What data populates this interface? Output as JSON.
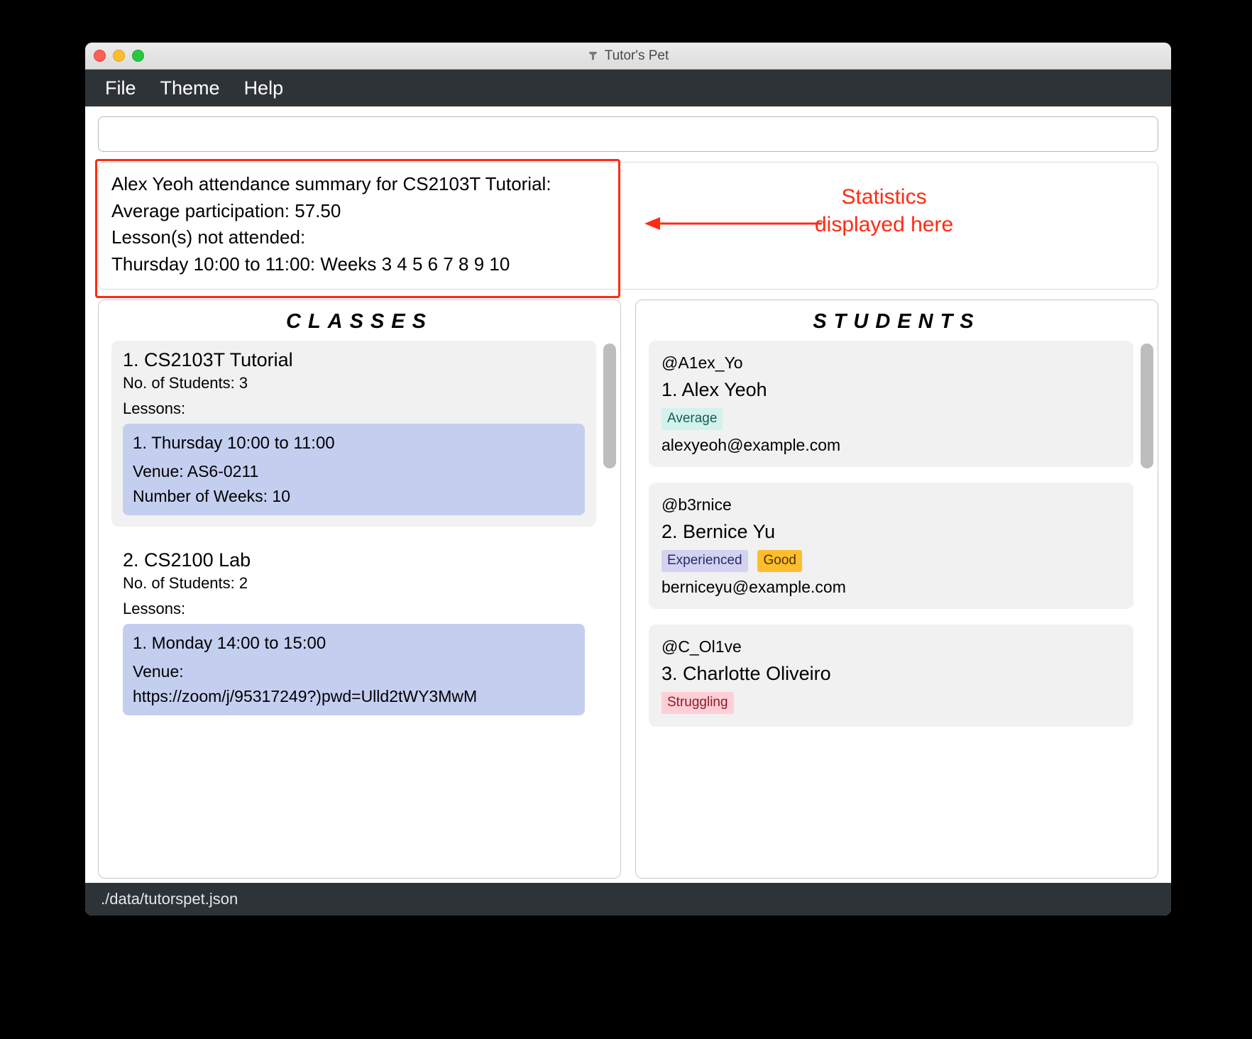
{
  "window": {
    "title": "Tutor's Pet"
  },
  "menu": {
    "file": "File",
    "theme": "Theme",
    "help": "Help"
  },
  "command": {
    "value": ""
  },
  "result": {
    "line1": "Alex Yeoh attendance summary for CS2103T Tutorial:",
    "line2": "Average participation: 57.50",
    "line3": "Lesson(s) not attended:",
    "line4": "Thursday 10:00 to 11:00: Weeks 3 4 5 6 7 8 9 10"
  },
  "annotation": {
    "line1": "Statistics",
    "line2": "displayed here"
  },
  "panels": {
    "classes_title": "CLASSES",
    "students_title": "STUDENTS"
  },
  "classes": [
    {
      "title": "1.  CS2103T Tutorial",
      "students_label": "No. of Students:  3",
      "lessons_label": "Lessons:",
      "lesson": {
        "title": "1. Thursday 10:00 to 11:00",
        "venue": "Venue: AS6-0211",
        "weeks": "Number of Weeks: 10"
      }
    },
    {
      "title": "2.  CS2100 Lab",
      "students_label": "No. of Students:  2",
      "lessons_label": "Lessons:",
      "lesson": {
        "title": "1. Monday 14:00 to 15:00",
        "venue": "Venue:",
        "weeks": "https://zoom/j/95317249?)pwd=Ulld2tWY3MwM"
      }
    }
  ],
  "students": [
    {
      "handle": "@A1ex_Yo",
      "name": "1.  Alex Yeoh",
      "tags": [
        {
          "text": "Average",
          "cls": "tag-average"
        }
      ],
      "email": "alexyeoh@example.com"
    },
    {
      "handle": "@b3rnice",
      "name": "2.  Bernice Yu",
      "tags": [
        {
          "text": "Experienced",
          "cls": "tag-exp"
        },
        {
          "text": "Good",
          "cls": "tag-good"
        }
      ],
      "email": "berniceyu@example.com"
    },
    {
      "handle": "@C_Ol1ve",
      "name": "3.  Charlotte Oliveiro",
      "tags": [
        {
          "text": "Struggling",
          "cls": "tag-struggling"
        }
      ],
      "email": ""
    }
  ],
  "statusbar": {
    "path": "./data/tutorspet.json"
  }
}
